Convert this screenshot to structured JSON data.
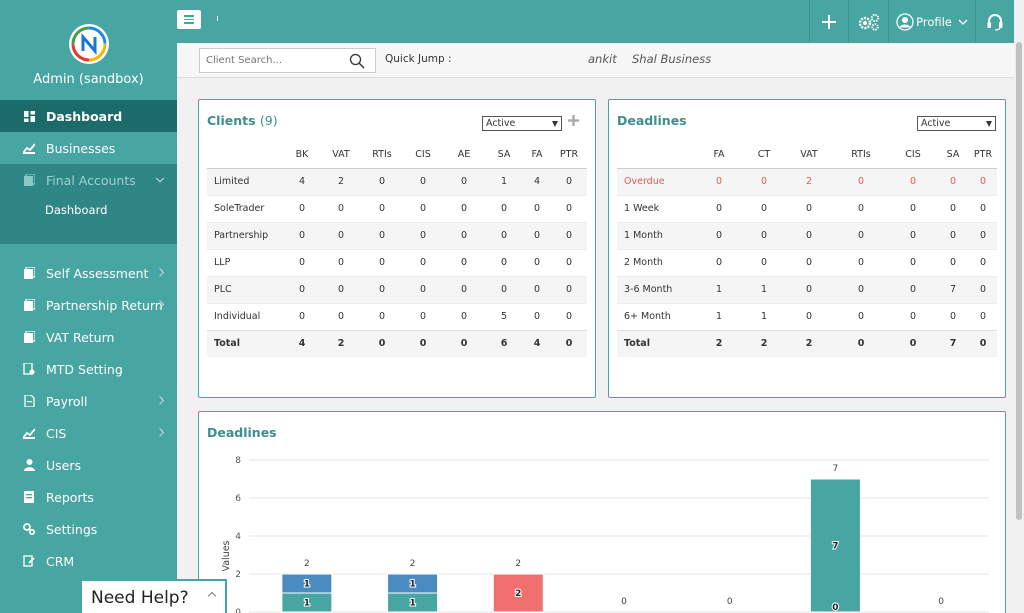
{
  "brand": {
    "title": "Admin (sandbox)"
  },
  "sidebar": {
    "items": [
      {
        "label": "Dashboard",
        "icon": "dashboard-icon"
      },
      {
        "label": "Businesses",
        "icon": "chart-icon"
      },
      {
        "label": "Final Accounts",
        "icon": "folder-icon"
      },
      {
        "label": "Self Assessment",
        "icon": "folder-icon"
      },
      {
        "label": "Partnership Return",
        "icon": "folder-icon"
      },
      {
        "label": "VAT Return",
        "icon": "folder-icon"
      },
      {
        "label": "MTD Setting",
        "icon": "gear-document-icon"
      },
      {
        "label": "Payroll",
        "icon": "file-icon"
      },
      {
        "label": "CIS",
        "icon": "chart-icon"
      },
      {
        "label": "Users",
        "icon": "user-icon"
      },
      {
        "label": "Reports",
        "icon": "report-icon"
      },
      {
        "label": "Settings",
        "icon": "gear-icon"
      },
      {
        "label": "CRM",
        "icon": "crm-icon"
      }
    ],
    "sub_items": [
      {
        "label": "Dashboard"
      }
    ]
  },
  "topbar": {
    "profile_label": "Profile"
  },
  "search": {
    "placeholder": "Client Search...",
    "quick_jump_label": "Quick Jump :",
    "quick_jump_items": [
      "ankit",
      "Shal Business"
    ]
  },
  "clients": {
    "title": "Clients",
    "count": "(9)",
    "filter_value": "Active",
    "columns": [
      "",
      "BK",
      "VAT",
      "RTIs",
      "CIS",
      "AE",
      "SA",
      "FA",
      "PTR"
    ],
    "rows": [
      [
        "Limited",
        "4",
        "2",
        "0",
        "0",
        "0",
        "1",
        "4",
        "0"
      ],
      [
        "SoleTrader",
        "0",
        "0",
        "0",
        "0",
        "0",
        "0",
        "0",
        "0"
      ],
      [
        "Partnership",
        "0",
        "0",
        "0",
        "0",
        "0",
        "0",
        "0",
        "0"
      ],
      [
        "LLP",
        "0",
        "0",
        "0",
        "0",
        "0",
        "0",
        "0",
        "0"
      ],
      [
        "PLC",
        "0",
        "0",
        "0",
        "0",
        "0",
        "0",
        "0",
        "0"
      ],
      [
        "Individual",
        "0",
        "0",
        "0",
        "0",
        "0",
        "5",
        "0",
        "0"
      ],
      [
        "Total",
        "4",
        "2",
        "0",
        "0",
        "0",
        "6",
        "4",
        "0"
      ]
    ]
  },
  "deadlines_table": {
    "title": "Deadlines",
    "filter_value": "Active",
    "columns": [
      "",
      "FA",
      "CT",
      "VAT",
      "RTIs",
      "CIS",
      "SA",
      "PTR"
    ],
    "rows": [
      [
        "Overdue",
        "0",
        "0",
        "2",
        "0",
        "0",
        "0",
        "0"
      ],
      [
        "1 Week",
        "0",
        "0",
        "0",
        "0",
        "0",
        "0",
        "0"
      ],
      [
        "1 Month",
        "0",
        "0",
        "0",
        "0",
        "0",
        "0",
        "0"
      ],
      [
        "2 Month",
        "0",
        "0",
        "0",
        "0",
        "0",
        "0",
        "0"
      ],
      [
        "3-6 Month",
        "1",
        "1",
        "0",
        "0",
        "0",
        "7",
        "0"
      ],
      [
        "6+ Month",
        "1",
        "1",
        "0",
        "0",
        "0",
        "0",
        "0"
      ],
      [
        "Total",
        "2",
        "2",
        "2",
        "0",
        "0",
        "7",
        "0"
      ]
    ]
  },
  "chart_data": {
    "type": "bar",
    "title": "Deadlines",
    "ylabel": "Values",
    "ylim": [
      0,
      8
    ],
    "yticks": [
      0,
      2,
      4,
      6,
      8
    ],
    "grid": true,
    "totals": [
      2,
      2,
      2,
      0,
      0,
      7,
      0
    ],
    "series": [
      {
        "values": [
          1,
          1,
          0,
          0,
          0,
          0,
          0
        ],
        "color": "#47a5a2"
      },
      {
        "values": [
          1,
          1,
          0,
          0,
          0,
          0,
          0
        ],
        "color": "#4a8bc2"
      },
      {
        "values": [
          0,
          0,
          2,
          0,
          0,
          0,
          0
        ],
        "color": "#f07070"
      },
      {
        "values": [
          0,
          0,
          0,
          0,
          0,
          7,
          0
        ],
        "color": "#47a5a2"
      }
    ],
    "segment_labels": [
      "1",
      "1",
      "1",
      "1",
      "2",
      "7",
      "0"
    ]
  },
  "help": {
    "label": "Need Help?"
  },
  "colors": {
    "accent": "#47a5a2",
    "accent_dark": "#1c6a69",
    "overdue": "#e05a5a"
  }
}
